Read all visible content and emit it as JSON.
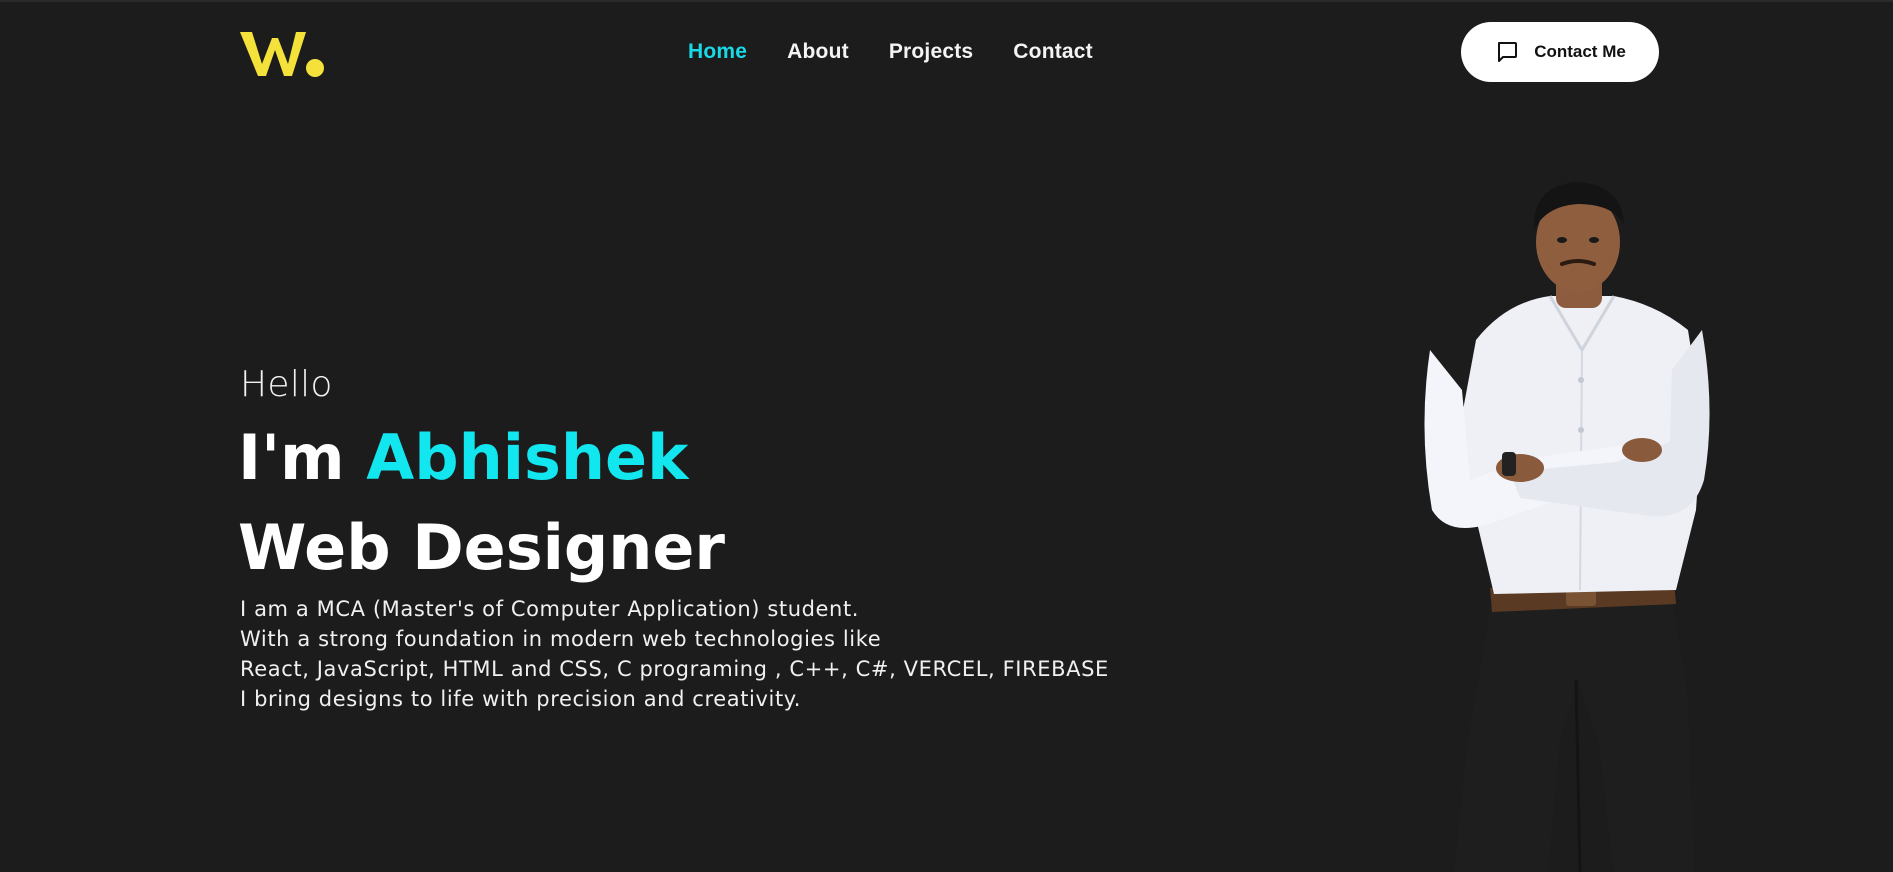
{
  "header": {
    "logo_text": "W.",
    "logo_color": "#f4e23a",
    "nav": [
      {
        "label": "Home",
        "active": true
      },
      {
        "label": "About",
        "active": false
      },
      {
        "label": "Projects",
        "active": false
      },
      {
        "label": "Contact",
        "active": false
      }
    ],
    "contact_button": {
      "label": "Contact Me",
      "icon": "chat-bubble-icon"
    }
  },
  "hero": {
    "greeting": "Hello",
    "intro_prefix": "I'm",
    "name": "Abhishek",
    "role": "Web Designer",
    "bio": [
      "I am a MCA (Master's of Computer Application) student.",
      "With a strong foundation in modern web technologies like",
      "React, JavaScript, HTML and CSS, C programing , C++, C#, VERCEL, FIREBASE",
      "I bring designs to life with precision and creativity."
    ],
    "portrait": "profile-photo"
  },
  "colors": {
    "background": "#1c1c1c",
    "accent": "#12e6ee",
    "nav_active": "#1ad8e6",
    "text": "#ffffff"
  }
}
